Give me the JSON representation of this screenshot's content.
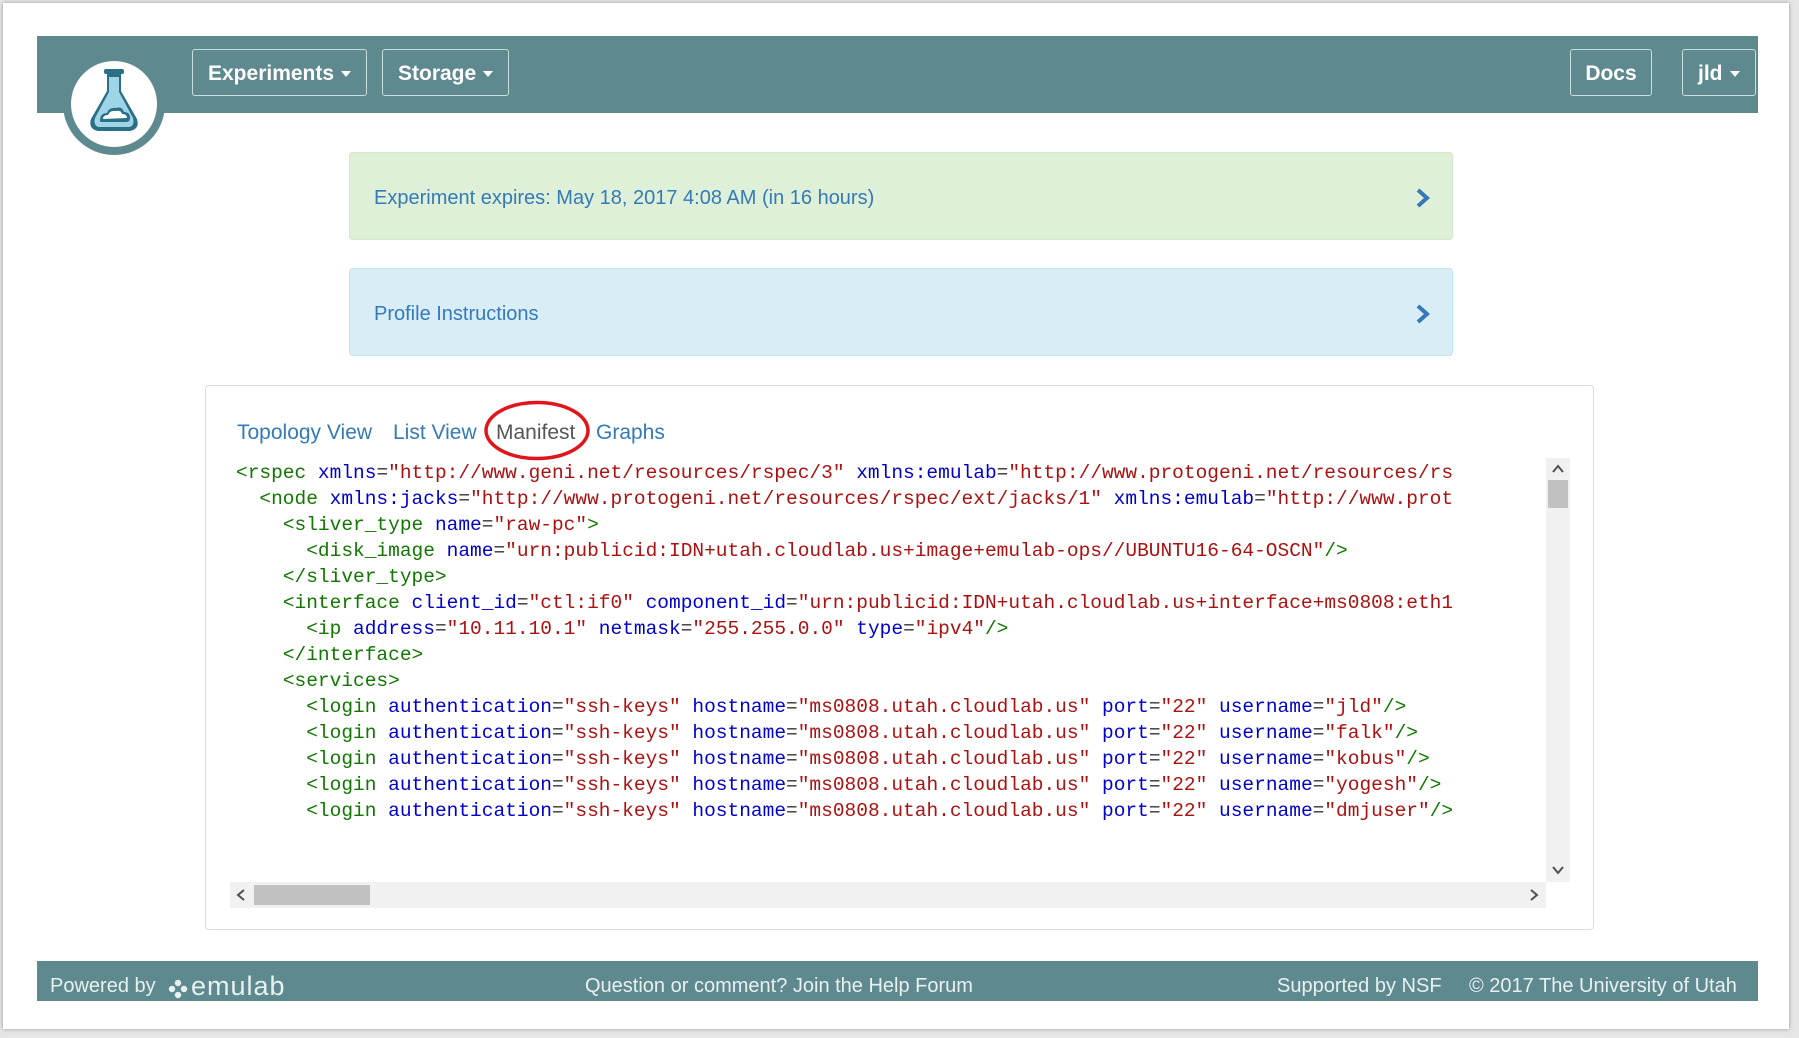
{
  "nav": {
    "experiments_label": "Experiments",
    "storage_label": "Storage",
    "docs_label": "Docs",
    "user_label": "jld"
  },
  "alerts": {
    "expiry_text": "Experiment expires: May 18, 2017 4:08 AM (in 16 hours)",
    "instructions_text": "Profile Instructions"
  },
  "tabs": {
    "topology": "Topology View",
    "list": "List View",
    "manifest": "Manifest",
    "graphs": "Graphs"
  },
  "manifest": {
    "rspec_ns": "\"http://www.geni.net/resources/rspec/3\"",
    "rspec_emulab": "\"http://www.protogeni.net/resources/rs",
    "jacks_ns": "\"http://www.protogeni.net/resources/rspec/ext/jacks/1\"",
    "node_emulab": "\"http://www.prot",
    "sliver_name": "\"raw-pc\"",
    "disk_name": "\"urn:publicid:IDN+utah.cloudlab.us+image+emulab-ops//UBUNTU16-64-OSCN\"",
    "client_id": "\"ctl:if0\"",
    "component_id": "\"urn:publicid:IDN+utah.cloudlab.us+interface+ms0808:eth1",
    "ip_address": "\"10.11.10.1\"",
    "netmask": "\"255.255.0.0\"",
    "ip_type": "\"ipv4\"",
    "auth": "\"ssh-keys\"",
    "hostname": "\"ms0808.utah.cloudlab.us\"",
    "port": "\"22\"",
    "user1": "\"jld\"",
    "user2": "\"falk\"",
    "user3": "\"kobus\"",
    "user4": "\"yogesh\"",
    "user5": "\"dmjuser\""
  },
  "footer": {
    "powered_by": "Powered by",
    "brand": "emulab",
    "help_text": "Question or comment? Join the Help Forum",
    "nsf_text": "Supported by NSF",
    "copyright": "© 2017 The University of Utah"
  },
  "colors": {
    "navbar": "#5e8a8f",
    "expiry_bg": "#dff0d8",
    "instructions_bg": "#d9edf7",
    "link": "#337ab7",
    "highlight_oval": "#e0161b"
  }
}
